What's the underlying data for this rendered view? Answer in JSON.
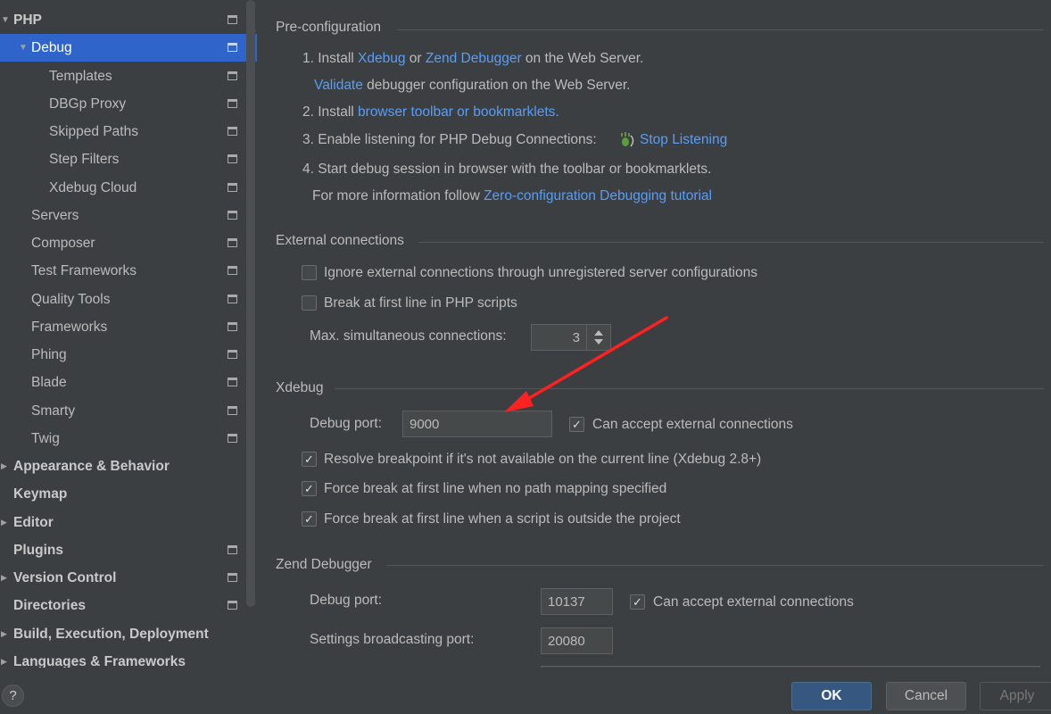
{
  "sidebar": {
    "items": [
      {
        "label": "PHP",
        "bold": true,
        "arrow": "down",
        "icon": true
      },
      {
        "label": "Debug",
        "arrow": "down",
        "icon": true,
        "selected": true
      },
      {
        "label": "Templates",
        "icon": true
      },
      {
        "label": "DBGp Proxy",
        "icon": true
      },
      {
        "label": "Skipped Paths",
        "icon": true
      },
      {
        "label": "Step Filters",
        "icon": true
      },
      {
        "label": "Xdebug Cloud",
        "icon": true
      },
      {
        "label": "Servers",
        "icon": true
      },
      {
        "label": "Composer",
        "icon": true
      },
      {
        "label": "Test Frameworks",
        "icon": true
      },
      {
        "label": "Quality Tools",
        "icon": true
      },
      {
        "label": "Frameworks",
        "icon": true
      },
      {
        "label": "Phing",
        "icon": true
      },
      {
        "label": "Blade",
        "icon": true
      },
      {
        "label": "Smarty",
        "icon": true
      },
      {
        "label": "Twig",
        "icon": true
      },
      {
        "label": "Appearance & Behavior",
        "bold": true,
        "arrow": "right"
      },
      {
        "label": "Keymap",
        "bold": true
      },
      {
        "label": "Editor",
        "bold": true,
        "arrow": "right"
      },
      {
        "label": "Plugins",
        "bold": true,
        "icon": true
      },
      {
        "label": "Version Control",
        "bold": true,
        "arrow": "right",
        "icon": true
      },
      {
        "label": "Directories",
        "bold": true,
        "icon": true
      },
      {
        "label": "Build, Execution, Deployment",
        "bold": true,
        "arrow": "right"
      },
      {
        "label": "Languages & Frameworks",
        "bold": true,
        "arrow": "right"
      }
    ]
  },
  "preconfig": {
    "title": "Pre-configuration",
    "step1_prefix": "1. Install ",
    "step1_link1": "Xdebug",
    "step1_or": " or ",
    "step1_link2": "Zend Debugger",
    "step1_suffix": " on the Web Server.",
    "validate_link": "Validate",
    "validate_suffix": " debugger configuration on the Web Server.",
    "step2_prefix": "2. Install ",
    "step2_link": "browser toolbar or bookmarklets.",
    "step3_prefix": "3. Enable listening for PHP Debug Connections:",
    "step3_link": "Stop Listening",
    "step4": "4. Start debug session in browser with the toolbar or bookmarklets.",
    "more_prefix": "For more information follow ",
    "more_link": "Zero-configuration Debugging tutorial"
  },
  "external": {
    "title": "External connections",
    "ignore_label": "Ignore external connections through unregistered server configurations",
    "ignore_checked": false,
    "break_label": "Break at first line in PHP scripts",
    "break_checked": false,
    "max_label": "Max. simultaneous connections:",
    "max_value": "3"
  },
  "xdebug": {
    "title": "Xdebug",
    "port_label": "Debug port:",
    "port_value": "9000",
    "accept_label": "Can accept external connections",
    "accept_checked": true,
    "resolve_label": "Resolve breakpoint if it's not available on the current line (Xdebug 2.8+)",
    "resolve_checked": true,
    "force_path_label": "Force break at first line when no path mapping specified",
    "force_path_checked": true,
    "force_outside_label": "Force break at first line when a script is outside the project",
    "force_outside_checked": true
  },
  "zend": {
    "title": "Zend Debugger",
    "port_label": "Debug port:",
    "port_value": "10137",
    "accept_label": "Can accept external connections",
    "accept_checked": true,
    "broadcast_label": "Settings broadcasting port:",
    "broadcast_value": "20080"
  },
  "footer": {
    "help": "?",
    "ok": "OK",
    "cancel": "Cancel",
    "apply": "Apply"
  },
  "colors": {
    "background": "#3c3f41",
    "selection": "#2f65ca",
    "link": "#589df6",
    "annotation_arrow": "#ff2020"
  },
  "check_glyph": "✓"
}
